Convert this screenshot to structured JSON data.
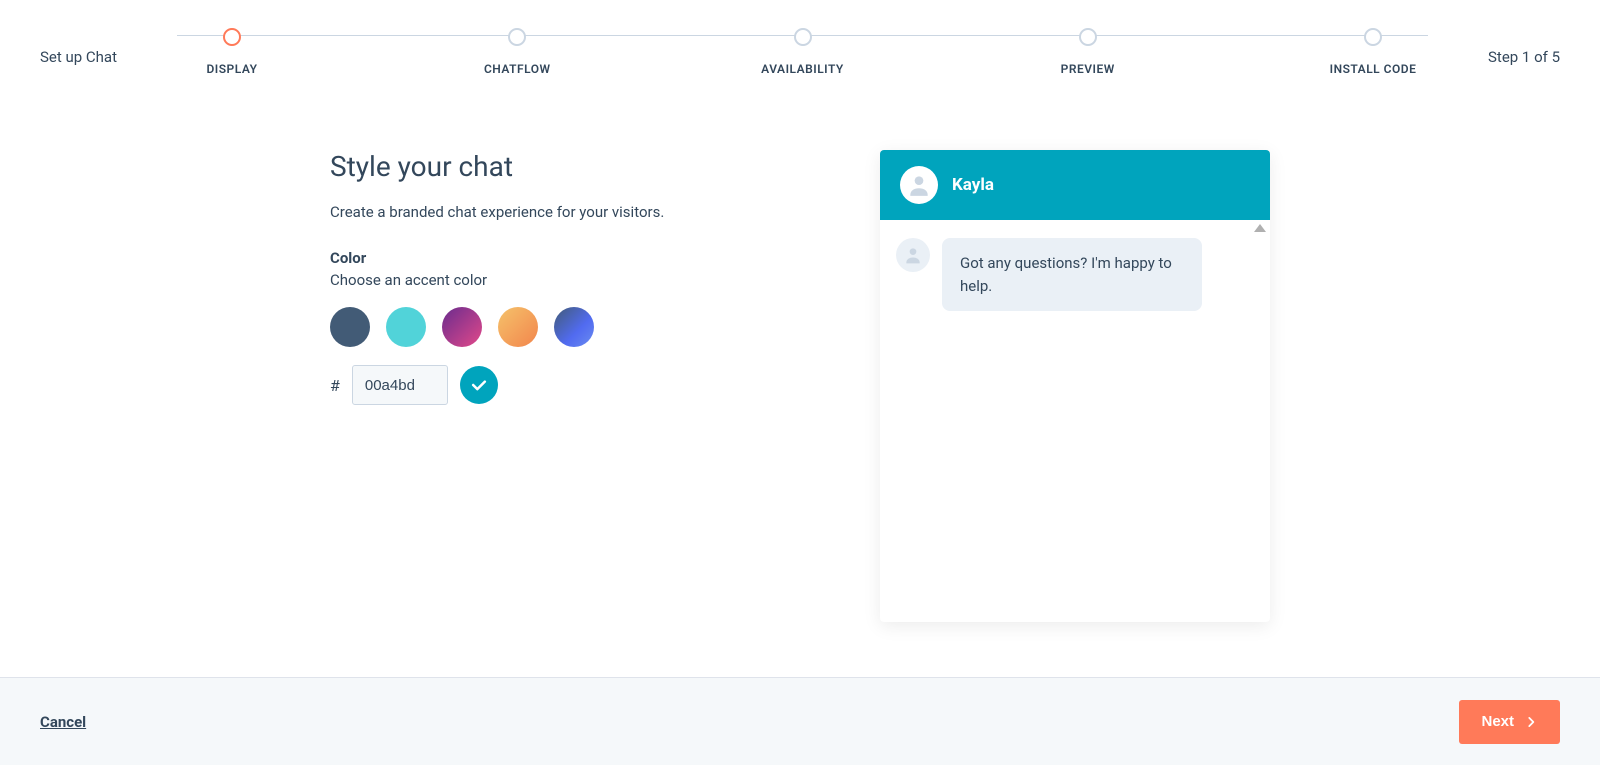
{
  "header": {
    "title": "Set up Chat",
    "step_count": "Step 1 of 5"
  },
  "stepper": {
    "steps": [
      {
        "label": "DISPLAY",
        "active": true
      },
      {
        "label": "CHATFLOW",
        "active": false
      },
      {
        "label": "AVAILABILITY",
        "active": false
      },
      {
        "label": "PREVIEW",
        "active": false
      },
      {
        "label": "INSTALL CODE",
        "active": false
      }
    ]
  },
  "content": {
    "title": "Style your chat",
    "subtitle": "Create a branded chat experience for your visitors.",
    "color_label": "Color",
    "color_help": "Choose an accent color",
    "hash": "#",
    "color_value": "00a4bd",
    "swatches": [
      "#425b76",
      "#51d3d9",
      "gradient-pink",
      "gradient-orange",
      "gradient-blue"
    ]
  },
  "preview": {
    "agent_name": "Kayla",
    "message": "Got any questions? I'm happy to help."
  },
  "footer": {
    "cancel": "Cancel",
    "next": "Next"
  }
}
